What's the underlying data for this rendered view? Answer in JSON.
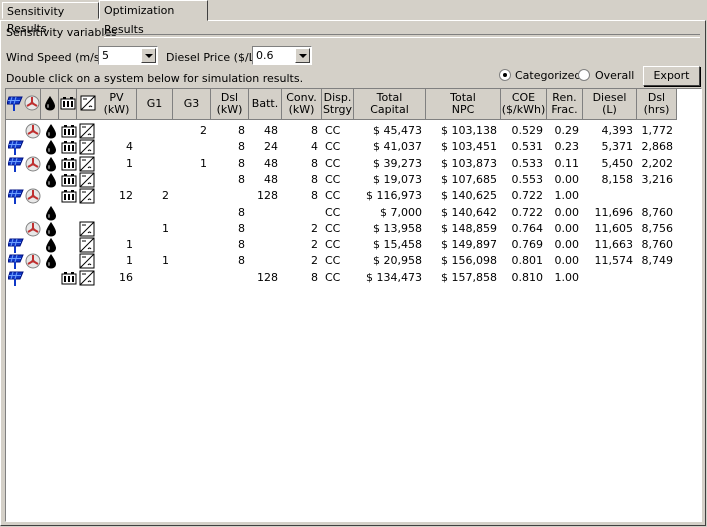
{
  "tabs": [
    {
      "label": "Sensitivity Results"
    },
    {
      "label": "Optimization Results"
    }
  ],
  "sensitivity": {
    "group_label": "Sensitivity variables",
    "wind_label": "Wind Speed (m/s)",
    "wind_value": "5",
    "diesel_label": "Diesel Price ($/L)",
    "diesel_value": "0.6"
  },
  "hint": "Double click on a system below for simulation results.",
  "view": {
    "categorized_label": "Categorized",
    "overall_label": "Overall",
    "selected": "categorized",
    "export_label": "Export"
  },
  "columns": [
    "PV (kW)",
    "G1",
    "G3",
    "Dsl (kW)",
    "Batt.",
    "Conv. (kW)",
    "Disp. Strgy",
    "Total Capital",
    "Total NPC",
    "COE ($/kWh)",
    "Ren. Frac.",
    "Diesel (L)",
    "Dsl (hrs)"
  ],
  "rows": [
    {
      "icons": [
        "",
        "wind",
        "diesel",
        "batt",
        "conv"
      ],
      "pv": "",
      "g1": "",
      "g3": "2",
      "dsl": "8",
      "batt": "48",
      "conv": "8",
      "disp": "CC",
      "capital": "$ 45,473",
      "npc": "$ 103,138",
      "coe": "0.529",
      "ren": "0.29",
      "diesel": "4,393",
      "hrs": "1,772"
    },
    {
      "icons": [
        "pv",
        "",
        "diesel",
        "batt",
        "conv"
      ],
      "pv": "4",
      "g1": "",
      "g3": "",
      "dsl": "8",
      "batt": "24",
      "conv": "4",
      "disp": "CC",
      "capital": "$ 41,037",
      "npc": "$ 103,451",
      "coe": "0.531",
      "ren": "0.23",
      "diesel": "5,371",
      "hrs": "2,868"
    },
    {
      "icons": [
        "pv",
        "wind",
        "diesel",
        "batt",
        "conv"
      ],
      "pv": "1",
      "g1": "",
      "g3": "1",
      "dsl": "8",
      "batt": "48",
      "conv": "8",
      "disp": "CC",
      "capital": "$ 39,273",
      "npc": "$ 103,873",
      "coe": "0.533",
      "ren": "0.11",
      "diesel": "5,450",
      "hrs": "2,202"
    },
    {
      "icons": [
        "",
        "",
        "diesel",
        "batt",
        "conv"
      ],
      "pv": "",
      "g1": "",
      "g3": "",
      "dsl": "8",
      "batt": "48",
      "conv": "8",
      "disp": "CC",
      "capital": "$ 19,073",
      "npc": "$ 107,685",
      "coe": "0.553",
      "ren": "0.00",
      "diesel": "8,158",
      "hrs": "3,216"
    },
    {
      "icons": [
        "pv",
        "wind",
        "",
        "batt",
        "conv"
      ],
      "pv": "12",
      "g1": "2",
      "g3": "",
      "dsl": "",
      "batt": "128",
      "conv": "8",
      "disp": "CC",
      "capital": "$ 116,973",
      "npc": "$ 140,625",
      "coe": "0.722",
      "ren": "1.00",
      "diesel": "",
      "hrs": ""
    },
    {
      "icons": [
        "",
        "",
        "diesel",
        "",
        ""
      ],
      "pv": "",
      "g1": "",
      "g3": "",
      "dsl": "8",
      "batt": "",
      "conv": "",
      "disp": "CC",
      "capital": "$ 7,000",
      "npc": "$ 140,642",
      "coe": "0.722",
      "ren": "0.00",
      "diesel": "11,696",
      "hrs": "8,760"
    },
    {
      "icons": [
        "",
        "wind",
        "diesel",
        "",
        "conv"
      ],
      "pv": "",
      "g1": "1",
      "g3": "",
      "dsl": "8",
      "batt": "",
      "conv": "2",
      "disp": "CC",
      "capital": "$ 13,958",
      "npc": "$ 148,859",
      "coe": "0.764",
      "ren": "0.00",
      "diesel": "11,605",
      "hrs": "8,756"
    },
    {
      "icons": [
        "pv",
        "",
        "diesel",
        "",
        "conv"
      ],
      "pv": "1",
      "g1": "",
      "g3": "",
      "dsl": "8",
      "batt": "",
      "conv": "2",
      "disp": "CC",
      "capital": "$ 15,458",
      "npc": "$ 149,897",
      "coe": "0.769",
      "ren": "0.00",
      "diesel": "11,663",
      "hrs": "8,760"
    },
    {
      "icons": [
        "pv",
        "wind",
        "diesel",
        "",
        "conv"
      ],
      "pv": "1",
      "g1": "1",
      "g3": "",
      "dsl": "8",
      "batt": "",
      "conv": "2",
      "disp": "CC",
      "capital": "$ 20,958",
      "npc": "$ 156,098",
      "coe": "0.801",
      "ren": "0.00",
      "diesel": "11,574",
      "hrs": "8,749"
    },
    {
      "icons": [
        "pv",
        "",
        "",
        "batt",
        "conv"
      ],
      "pv": "16",
      "g1": "",
      "g3": "",
      "dsl": "",
      "batt": "128",
      "conv": "8",
      "disp": "CC",
      "capital": "$ 134,473",
      "npc": "$ 157,858",
      "coe": "0.810",
      "ren": "1.00",
      "diesel": "",
      "hrs": ""
    }
  ]
}
